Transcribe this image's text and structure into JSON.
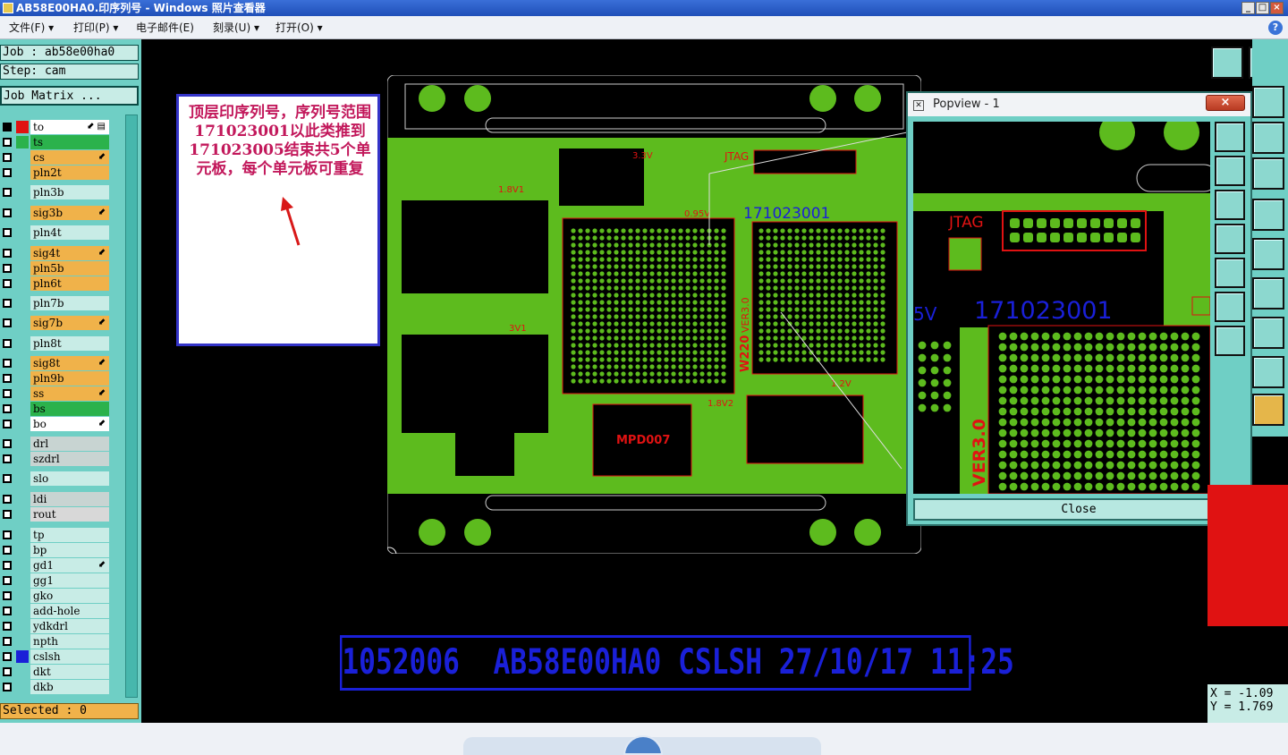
{
  "window": {
    "title": "AB58E00HA0.印序列号 - Windows 照片查看器",
    "btn_min": "_",
    "btn_max": "□",
    "btn_close": "×"
  },
  "menu": [
    {
      "label": "文件(F) ▾"
    },
    {
      "label": "打印(P) ▾"
    },
    {
      "label": "电子邮件(E)"
    },
    {
      "label": "刻录(U) ▾"
    },
    {
      "label": "打开(O) ▾"
    }
  ],
  "help": "?",
  "job": {
    "job_line": "Job : ab58e00ha0",
    "step_line": "Step: cam",
    "matrix_btn": "Job Matrix ..."
  },
  "layers": [
    {
      "name": "to",
      "color": "#e01212",
      "fill": "#ffffff",
      "arrow": "⬋ ▤"
    },
    {
      "name": "ts",
      "color": "#2bb24c",
      "fill": "#2bb24c",
      "arrow": ""
    },
    {
      "name": "cs",
      "color": "",
      "fill": "#f0b24a",
      "arrow": "⬋"
    },
    {
      "name": "pln2t",
      "color": "",
      "fill": "#f0b24a",
      "arrow": ""
    },
    {
      "name": "pln3b",
      "color": "",
      "fill": "#c8ece6",
      "arrow": ""
    },
    {
      "name": "sig3b",
      "color": "",
      "fill": "#f0b24a",
      "arrow": "⬋"
    },
    {
      "name": "pln4t",
      "color": "",
      "fill": "#c8ece6",
      "arrow": ""
    },
    {
      "name": "sig4t",
      "color": "",
      "fill": "#f0b24a",
      "arrow": "⬋"
    },
    {
      "name": "pln5b",
      "color": "",
      "fill": "#f0b24a",
      "arrow": ""
    },
    {
      "name": "pln6t",
      "color": "",
      "fill": "#f0b24a",
      "arrow": ""
    },
    {
      "name": "pln7b",
      "color": "",
      "fill": "#c8ece6",
      "arrow": ""
    },
    {
      "name": "sig7b",
      "color": "",
      "fill": "#f0b24a",
      "arrow": "⬋"
    },
    {
      "name": "pln8t",
      "color": "",
      "fill": "#c8ece6",
      "arrow": ""
    },
    {
      "name": "sig8t",
      "color": "",
      "fill": "#f0b24a",
      "arrow": "⬋"
    },
    {
      "name": "pln9b",
      "color": "",
      "fill": "#f0b24a",
      "arrow": ""
    },
    {
      "name": "ss",
      "color": "",
      "fill": "#f0b24a",
      "arrow": "⬋"
    },
    {
      "name": "bs",
      "color": "",
      "fill": "#2bb24c",
      "arrow": ""
    },
    {
      "name": "bo",
      "color": "",
      "fill": "#ffffff",
      "arrow": "⬋"
    },
    {
      "name": "drl",
      "color": "",
      "fill": "#c8d4d2",
      "arrow": ""
    },
    {
      "name": "szdrl",
      "color": "",
      "fill": "#c8d4d2",
      "arrow": ""
    },
    {
      "name": "slo",
      "color": "",
      "fill": "#c8ece6",
      "arrow": ""
    },
    {
      "name": "ldi",
      "color": "",
      "fill": "#c8d4d2",
      "arrow": ""
    },
    {
      "name": "rout",
      "color": "",
      "fill": "#d8d8d8",
      "arrow": ""
    },
    {
      "name": "tp",
      "color": "",
      "fill": "#c8ece6",
      "arrow": ""
    },
    {
      "name": "bp",
      "color": "",
      "fill": "#c8ece6",
      "arrow": ""
    },
    {
      "name": "gd1",
      "color": "",
      "fill": "#c8ece6",
      "arrow": "⬋"
    },
    {
      "name": "gg1",
      "color": "",
      "fill": "#c8ece6",
      "arrow": ""
    },
    {
      "name": "gko",
      "color": "",
      "fill": "#c8ece6",
      "arrow": ""
    },
    {
      "name": "add-hole",
      "color": "",
      "fill": "#c8ece6",
      "arrow": ""
    },
    {
      "name": "ydkdrl",
      "color": "",
      "fill": "#c8ece6",
      "arrow": ""
    },
    {
      "name": "npth",
      "color": "",
      "fill": "#c8ece6",
      "arrow": ""
    },
    {
      "name": "cslsh",
      "color": "#1a20d8",
      "fill": "#c8ece6",
      "arrow": ""
    },
    {
      "name": "dkt",
      "color": "",
      "fill": "#c8ece6",
      "arrow": ""
    },
    {
      "name": "dkb",
      "color": "",
      "fill": "#c8ece6",
      "arrow": ""
    }
  ],
  "selected": "Selected : 0",
  "annotation": "顶层印序列号，序列号范围171023001以此类推到171023005结束共5个单元板，每个单元板可重复",
  "board_labels": {
    "jtag": "JTAG",
    "serial": "171023001",
    "mpd": "MPD007",
    "w220": "W220",
    "ver": "VER3.0",
    "v33": "3.3V",
    "v18a": "1.8V1",
    "v18b": "1.8V2",
    "v095": "0.95V",
    "v12": "1.2V",
    "v3": "3V1"
  },
  "popview": {
    "title": "Popview - 1",
    "close_x": "×",
    "close_btn": "Close",
    "jtag": "JTAG",
    "serial": "171023001",
    "ver": "VER3.0",
    "v5": "5V"
  },
  "banner": "1052006  AB58E00HA0 CSLSH 27/10/17 11:25",
  "coords": {
    "x": "X = -1.09",
    "y": "Y = 1.769"
  },
  "colors": {
    "board": "#5dbb1e",
    "copper": "#e01212",
    "silk": "#1a20d8",
    "panel": "#6fcfc5"
  }
}
